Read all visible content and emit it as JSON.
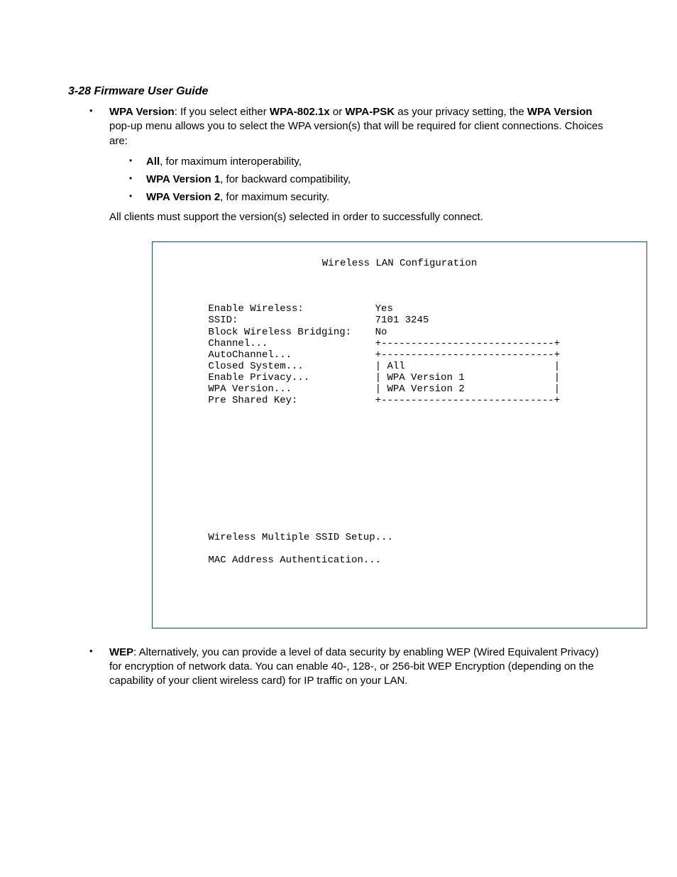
{
  "header": "3-28  Firmware User Guide",
  "item1": {
    "label": "WPA Version",
    "t1": ": If you select either ",
    "opt1": "WPA-802.1x",
    "t2": " or ",
    "opt2": "WPA-PSK",
    "t3": " as your privacy setting, the ",
    "label2": "WPA Version",
    "t4": " pop-up menu allows you to select the WPA version(s) that will be required for client connections. Choices are:"
  },
  "sub": {
    "a": {
      "b": "All",
      "t": ", for maximum interoperability,"
    },
    "b": {
      "b": "WPA Version 1",
      "t": ", for backward compatibility,"
    },
    "c": {
      "b": "WPA Version 2",
      "t": ", for maximum security."
    }
  },
  "note": "All clients must support the version(s) selected in order to successfully connect.",
  "config": {
    "title": "Wireless LAN Configuration",
    "rows": [
      {
        "l": "Enable Wireless:",
        "r": "Yes"
      },
      {
        "l": "SSID:",
        "r": "7101 3245"
      },
      {
        "l": "Block Wireless Bridging:",
        "r": "No"
      },
      {
        "l": "Channel...",
        "r": "+-----------------------------+"
      },
      {
        "l": "AutoChannel...",
        "r": "+-----------------------------+"
      },
      {
        "l": "Closed System...",
        "r": "| All                         |"
      },
      {
        "l": "Enable Privacy...",
        "r": "| WPA Version 1               |"
      },
      {
        "l": "WPA Version...",
        "r": "| WPA Version 2               |"
      },
      {
        "l": "Pre Shared Key:",
        "r": "+-----------------------------+"
      }
    ],
    "footer1": "Wireless Multiple SSID Setup...",
    "footer2": "MAC Address Authentication..."
  },
  "item2": {
    "label": "WEP",
    "t": ": Alternatively, you can provide a level of data security by enabling WEP (Wired Equivalent Privacy) for encryption of network data. You can enable 40-, 128-, or 256-bit WEP Encryption (depending on the capability of your client wireless card) for IP traffic on your LAN."
  }
}
